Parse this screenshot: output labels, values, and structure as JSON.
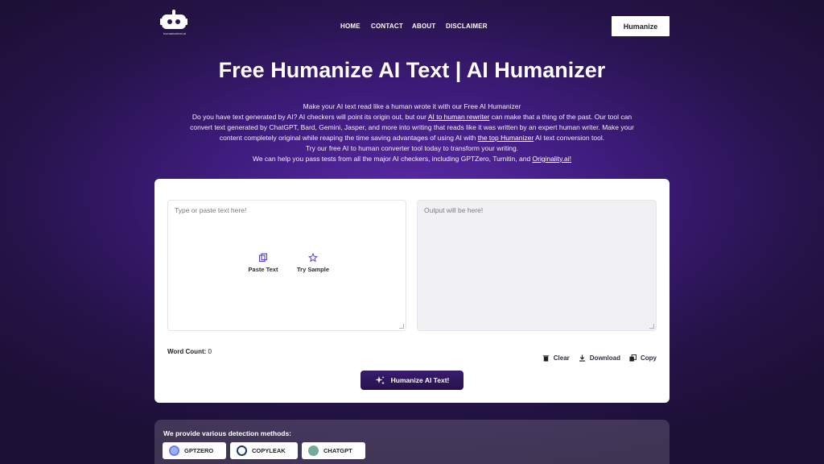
{
  "nav": {
    "logo_caption": "humanizetext.ai",
    "items": [
      {
        "label": "HOME"
      },
      {
        "label": "CONTACT"
      },
      {
        "label": "ABOUT"
      },
      {
        "label": "DISCLAIMER"
      }
    ],
    "cta_label": "Humanize"
  },
  "hero": {
    "title": "Free Humanize AI Text | AI Humanizer",
    "line1": "Make your AI text read like a human wrote it with our Free AI Humanizer",
    "line2a": "Do you have text generated by AI? AI checkers will point its origin out, but our ",
    "link1": "AI to human rewriter",
    "line2b": " can make that a thing of the past. Our tool can convert text generated by ChatGPT, Bard, Gemini, Jasper, and more into writing that reads like it was written by an expert human writer. Make your content completely original while reaping the time saving advantages of using AI with ",
    "link2": "the top Humanizer",
    "line2c": " AI text conversion tool.",
    "line3": "Try our free AI to human converter tool today to transform your writing.",
    "line4a": "We can help you pass tests from all the major AI checkers, including GPTZero, Turnitin, and ",
    "link3": "Originality.ai!"
  },
  "tool": {
    "input_placeholder": "Type or paste text here!",
    "output_placeholder": "Output will be here!",
    "paste_label": "Paste Text",
    "sample_label": "Try Sample",
    "word_count_label": "Word Count:",
    "word_count_value": "0",
    "clear_label": "Clear",
    "download_label": "Download",
    "copy_label": "Copy",
    "humanize_label": "Humanize AI Text!"
  },
  "detection": {
    "heading": "We provide various detection methods:",
    "methods": [
      {
        "label": "GPTZERO",
        "color": "#7a8cf0"
      },
      {
        "label": "COPYLEAK",
        "color": "#1b3c6b"
      },
      {
        "label": "CHATGPT",
        "color": "#74aa9c"
      }
    ]
  }
}
